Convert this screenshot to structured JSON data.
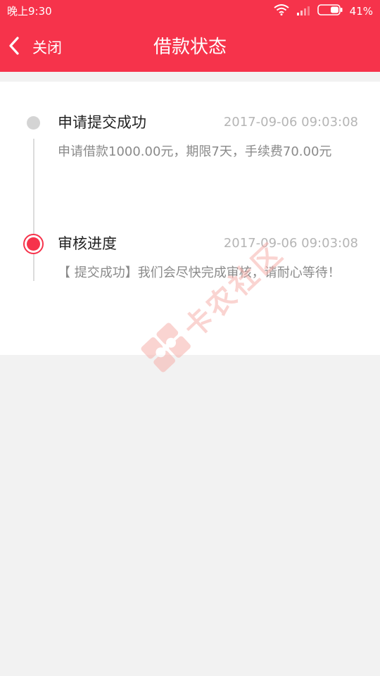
{
  "status_bar": {
    "time": "晚上9:30",
    "battery_pct": "41%",
    "icons": [
      "wifi-icon",
      "signal-icon",
      "battery-icon"
    ]
  },
  "nav": {
    "back_icon": "chevron-left-icon",
    "back_label": "关闭",
    "title": "借款状态"
  },
  "timeline": [
    {
      "title": "申请提交成功",
      "time": "2017-09-06 09:03:08",
      "desc": "申请借款1000.00元，期限7天，手续费70.00元",
      "state": "done"
    },
    {
      "title": "审核进度",
      "time": "2017-09-06 09:03:08",
      "desc": "【 提交成功】我们会尽快完成审核，请耐心等待！",
      "state": "current"
    }
  ],
  "watermark": {
    "text": "卡农社区"
  },
  "colors": {
    "brand": "#f6334b",
    "inactive_dot": "#d4d4d4",
    "background": "#f2f2f2"
  }
}
